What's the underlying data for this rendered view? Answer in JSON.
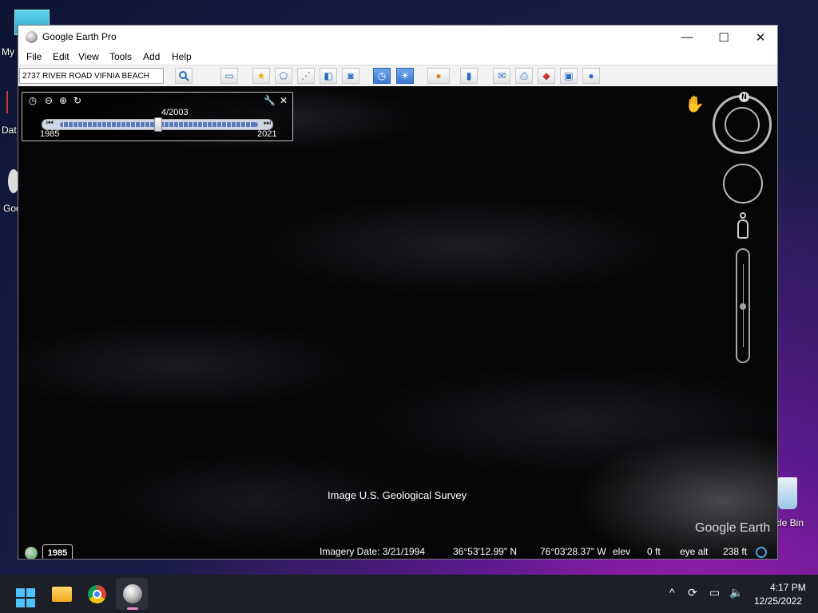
{
  "desktop": {
    "icons": [
      {
        "label": "My"
      },
      {
        "label": "Dat"
      },
      {
        "label": "Goo"
      },
      {
        "label": "cle Bin"
      }
    ]
  },
  "window": {
    "title": "Google Earth Pro",
    "controls": {
      "minimize": "—",
      "maximize": "☐",
      "close": "✕"
    }
  },
  "menu": [
    "File",
    "Edit",
    "View",
    "Tools",
    "Add",
    "Help"
  ],
  "search": {
    "value": "2737 RIVER ROAD VIFNIA BEACH",
    "button_icon": "search-icon"
  },
  "toolbar": {
    "buttons": [
      "sidebar",
      "placemark",
      "polygon",
      "path",
      "image-overlay",
      "record-tour",
      "historical-imagery",
      "sunlight",
      "planets",
      "ruler",
      "email",
      "print",
      "save-image",
      "view-in-maps",
      "google-earth-web"
    ],
    "active": [
      "historical-imagery",
      "sunlight"
    ]
  },
  "time_slider": {
    "current_label": "4/2003",
    "start_year": "1985",
    "end_year": "2021",
    "position_fraction": 0.5,
    "icons": {
      "clock": "◷",
      "zoom_out": "⊖",
      "zoom_in": "⊕",
      "refresh": "↻",
      "settings": "🔧",
      "close": "✕",
      "back": "⏮",
      "forward": "⏭"
    }
  },
  "map": {
    "attribution": "Image U.S. Geological Survey",
    "logo": "Google Earth",
    "compass_north": "N",
    "year_badge": "1985"
  },
  "status": {
    "imagery_date": "Imagery Date: 3/21/1994",
    "lat": "36°53'12.99\" N",
    "lon": "76°03'28.37\" W",
    "elev_label": "elev",
    "elev_value": "0 ft",
    "eye_label": "eye alt",
    "eye_value": "238 ft"
  },
  "taskbar": {
    "time": "4:17 PM",
    "date": "12/25/2022",
    "tray_icons": [
      "chevron-up-icon",
      "sync-icon",
      "display-icon",
      "volume-icon"
    ]
  }
}
